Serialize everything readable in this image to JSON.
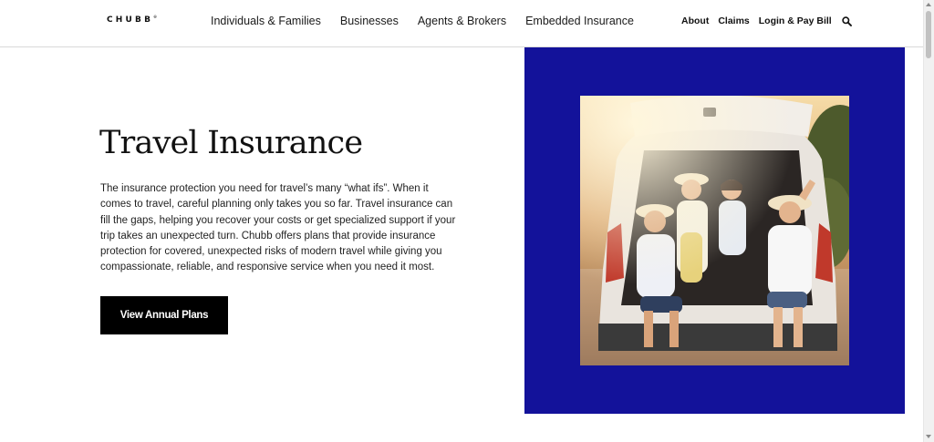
{
  "brand": {
    "logo_text": "CHUBB",
    "logo_mark": "®"
  },
  "nav": {
    "primary": [
      {
        "label": "Individuals & Families"
      },
      {
        "label": "Businesses"
      },
      {
        "label": "Agents & Brokers"
      },
      {
        "label": "Embedded Insurance"
      }
    ],
    "utility": [
      {
        "label": "About"
      },
      {
        "label": "Claims"
      },
      {
        "label": "Login & Pay Bill"
      }
    ],
    "search_icon": "search-icon"
  },
  "hero": {
    "title": "Travel Insurance",
    "description": "The insurance protection you need for travel’s many “what ifs”. When it comes to travel, careful planning only takes you so far. Travel insurance can fill the gaps, helping you recover your costs or get specialized support if your trip takes an unexpected turn. Chubb offers plans that provide insurance protection for covered, unexpected risks of modern travel while giving you compassionate, reliable, and responsive service when you need it most.",
    "cta_label": "View Annual Plans"
  },
  "colors": {
    "panel_blue": "#13129a",
    "cta_bg": "#000000",
    "text": "#111111"
  }
}
